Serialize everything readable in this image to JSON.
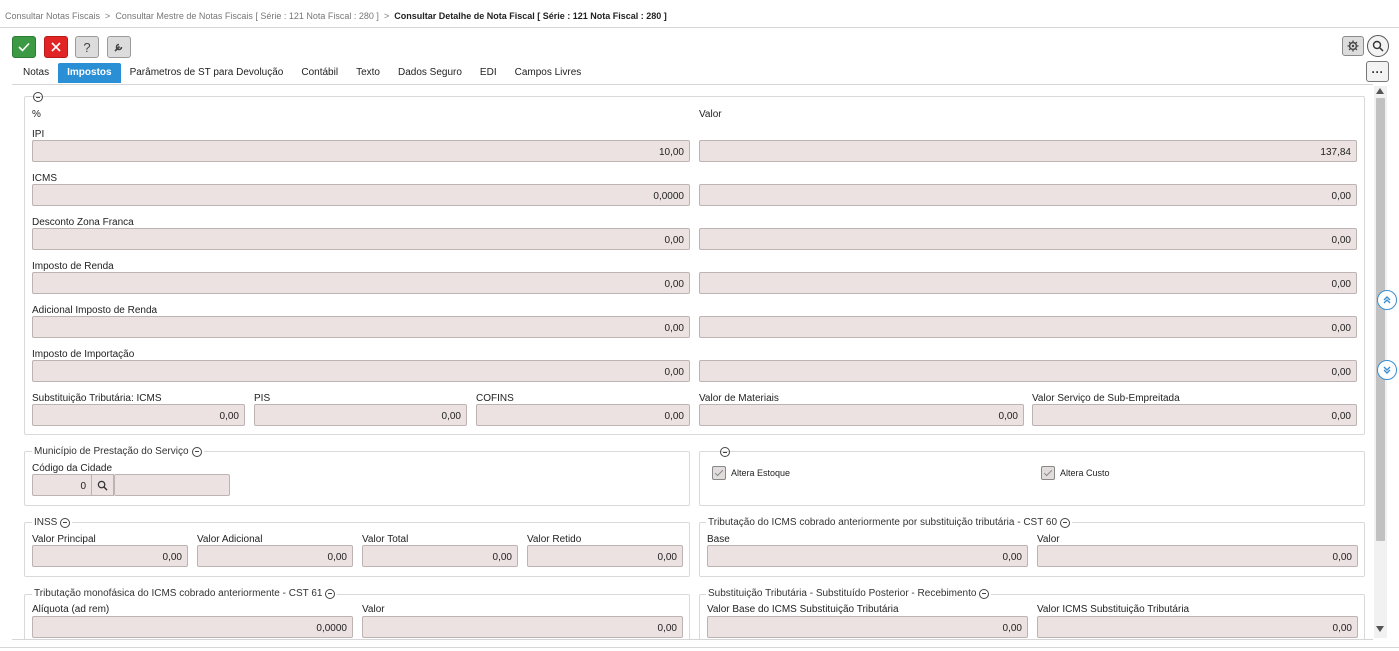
{
  "breadcrumb": {
    "items": [
      "Consultar Notas Fiscais",
      "Consultar Mestre de Notas Fiscais [ Série : 121 Nota Fiscal : 280 ]",
      "Consultar Detalhe de Nota Fiscal [ Série : 121 Nota Fiscal : 280 ]"
    ],
    "separator": ">"
  },
  "toolbar": {
    "ok_icon": "check-icon",
    "cancel_icon": "close-icon",
    "help_label": "?",
    "tool_icon": "wrench-icon",
    "gear_icon": "gear-icon",
    "search_icon": "search-icon",
    "more_label": "···"
  },
  "tabs": [
    {
      "label": "Notas",
      "active": false
    },
    {
      "label": "Impostos",
      "active": true
    },
    {
      "label": "Parâmetros de ST para Devolução",
      "active": false
    },
    {
      "label": "Contábil",
      "active": false
    },
    {
      "label": "Texto",
      "active": false
    },
    {
      "label": "Dados Seguro",
      "active": false
    },
    {
      "label": "EDI",
      "active": false
    },
    {
      "label": "Campos Livres",
      "active": false
    }
  ],
  "impostos": {
    "col_pct": "%",
    "col_valor": "Valor",
    "rows": [
      {
        "label": "IPI",
        "pct": "10,00",
        "valor": "137,84"
      },
      {
        "label": "ICMS",
        "pct": "0,0000",
        "valor": "0,00"
      },
      {
        "label": "Desconto Zona Franca",
        "pct": "0,00",
        "valor": "0,00"
      },
      {
        "label": "Imposto de Renda",
        "pct": "0,00",
        "valor": "0,00"
      },
      {
        "label": "Adicional Imposto de Renda",
        "pct": "0,00",
        "valor": "0,00"
      },
      {
        "label": "Imposto de Importação",
        "pct": "0,00",
        "valor": "0,00"
      }
    ],
    "bottom": [
      {
        "label": "Substituição Tributária: ICMS",
        "value": "0,00"
      },
      {
        "label": "PIS",
        "value": "0,00"
      },
      {
        "label": "COFINS",
        "value": "0,00"
      },
      {
        "label": "Valor de Materiais",
        "value": "0,00"
      },
      {
        "label": "Valor Serviço de Sub-Empreitada",
        "value": "0,00"
      }
    ]
  },
  "municipio": {
    "title": "Município de Prestação do Serviço",
    "label": "Código da Cidade",
    "code": "0",
    "name": ""
  },
  "estoque": {
    "altera_estoque": "Altera Estoque",
    "altera_custo": "Altera Custo"
  },
  "inss": {
    "title": "INSS",
    "fields": [
      {
        "label": "Valor Principal",
        "value": "0,00"
      },
      {
        "label": "Valor Adicional",
        "value": "0,00"
      },
      {
        "label": "Valor Total",
        "value": "0,00"
      },
      {
        "label": "Valor Retido",
        "value": "0,00"
      }
    ]
  },
  "cst60": {
    "title": "Tributação do ICMS cobrado anteriormente por substituição tributária - CST 60",
    "fields": [
      {
        "label": "Base",
        "value": "0,00"
      },
      {
        "label": "Valor",
        "value": "0,00"
      }
    ]
  },
  "cst61": {
    "title": "Tributação monofásica do ICMS cobrado anteriormente - CST 61",
    "fields": [
      {
        "label": "Alíquota (ad rem)",
        "value": "0,0000"
      },
      {
        "label": "Valor",
        "value": "0,00"
      }
    ]
  },
  "st_posterior": {
    "title": "Substituição Tributária - Substituído Posterior - Recebimento",
    "fields": [
      {
        "label": "Valor Base do ICMS Substituição Tributária",
        "value": "0,00"
      },
      {
        "label": "Valor ICMS Substituição Tributária",
        "value": "0,00"
      }
    ]
  }
}
